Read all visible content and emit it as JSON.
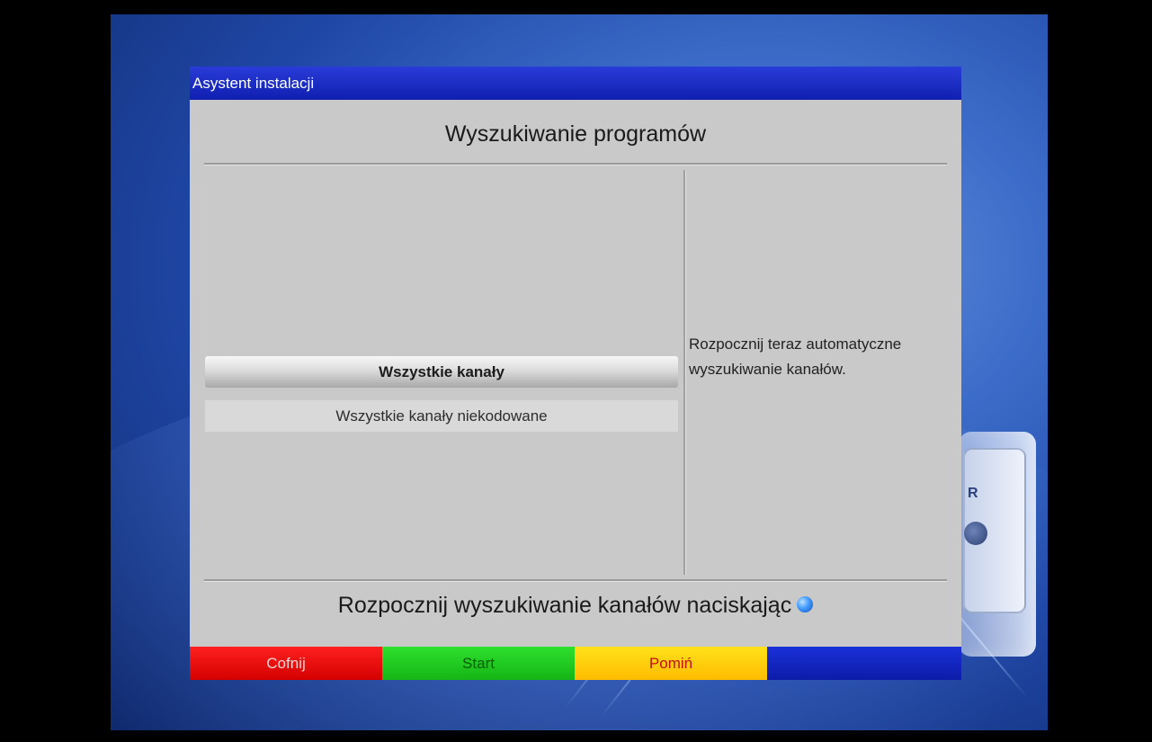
{
  "window": {
    "title": "Asystent instalacji"
  },
  "main": {
    "heading": "Wyszukiwanie programów",
    "options": [
      {
        "label": "Wszystkie kanały",
        "selected": true
      },
      {
        "label": "Wszystkie kanały niekodowane",
        "selected": false
      }
    ],
    "help_text": "Rozpocznij teraz automatyczne wyszukiwanie kanałów.",
    "hint_text": "Rozpocznij wyszukiwanie kanałów naciskając"
  },
  "decoration": {
    "socket_label": "R"
  },
  "function_keys": {
    "red_label": "Cofnij",
    "green_label": "Start",
    "yellow_label": "Pomiń",
    "blue_label": ""
  },
  "colors": {
    "titlebar": "#0f1fb0",
    "panel": "#c9c9c9",
    "red_key": "#d40000",
    "green_key": "#15b515",
    "yellow_key": "#ffbb00",
    "blue_key": "#0c1ca8"
  },
  "icons": {
    "hint_icon": "ok-button-icon"
  }
}
